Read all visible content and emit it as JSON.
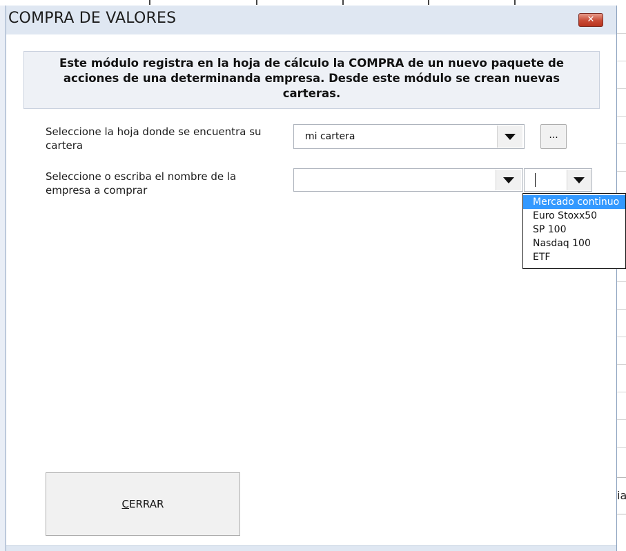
{
  "window": {
    "title": "COMPRA DE VALORES",
    "close_symbol": "✕"
  },
  "info": {
    "text": "Este módulo registra en la hoja de cálculo la COMPRA de un nuevo paquete de acciones de una determinanda empresa. Desde este módulo se crean nuevas carteras."
  },
  "sheet_select": {
    "label": "Seleccione la hoja donde se encuentra su cartera",
    "value": "mi cartera",
    "browse_label": "..."
  },
  "company_select": {
    "label": "Seleccione o escriba el nombre de la empresa a comprar",
    "value": "",
    "market_value": ""
  },
  "market_dropdown": {
    "options": [
      "Mercado continuo",
      "Euro Stoxx50",
      "SP 100",
      "Nasdaq 100",
      "ETF"
    ],
    "selected_index": 0
  },
  "buttons": {
    "close_first_letter": "C",
    "close_rest": "ERRAR"
  },
  "background": {
    "peek_text": "ia"
  },
  "colors": {
    "titlebar": "#dfe7f2",
    "info_box": "#eef1f6",
    "selection": "#3399ff",
    "close_button": "#c84a35"
  }
}
